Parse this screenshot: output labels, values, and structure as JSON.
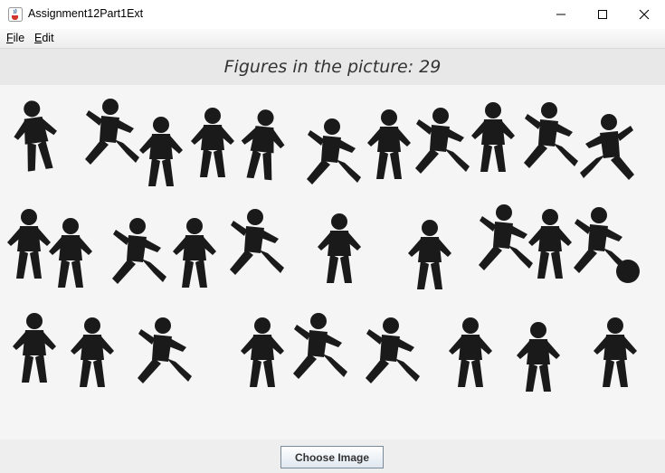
{
  "window": {
    "title": "Assignment12Part1Ext",
    "icon": "java-cup-icon",
    "controls": [
      "minimize-icon",
      "maximize-icon",
      "close-icon"
    ]
  },
  "menu": {
    "items": [
      {
        "label": "File"
      },
      {
        "label": "Edit"
      }
    ]
  },
  "main": {
    "figures_label": "Figures in the picture:  29",
    "figures_count": 29,
    "picture": {
      "icon": "children-silhouettes-image",
      "figure_color": "#1a1a1a",
      "background_color": "#f5f5f5"
    }
  },
  "footer": {
    "choose_button": "Choose Image"
  }
}
